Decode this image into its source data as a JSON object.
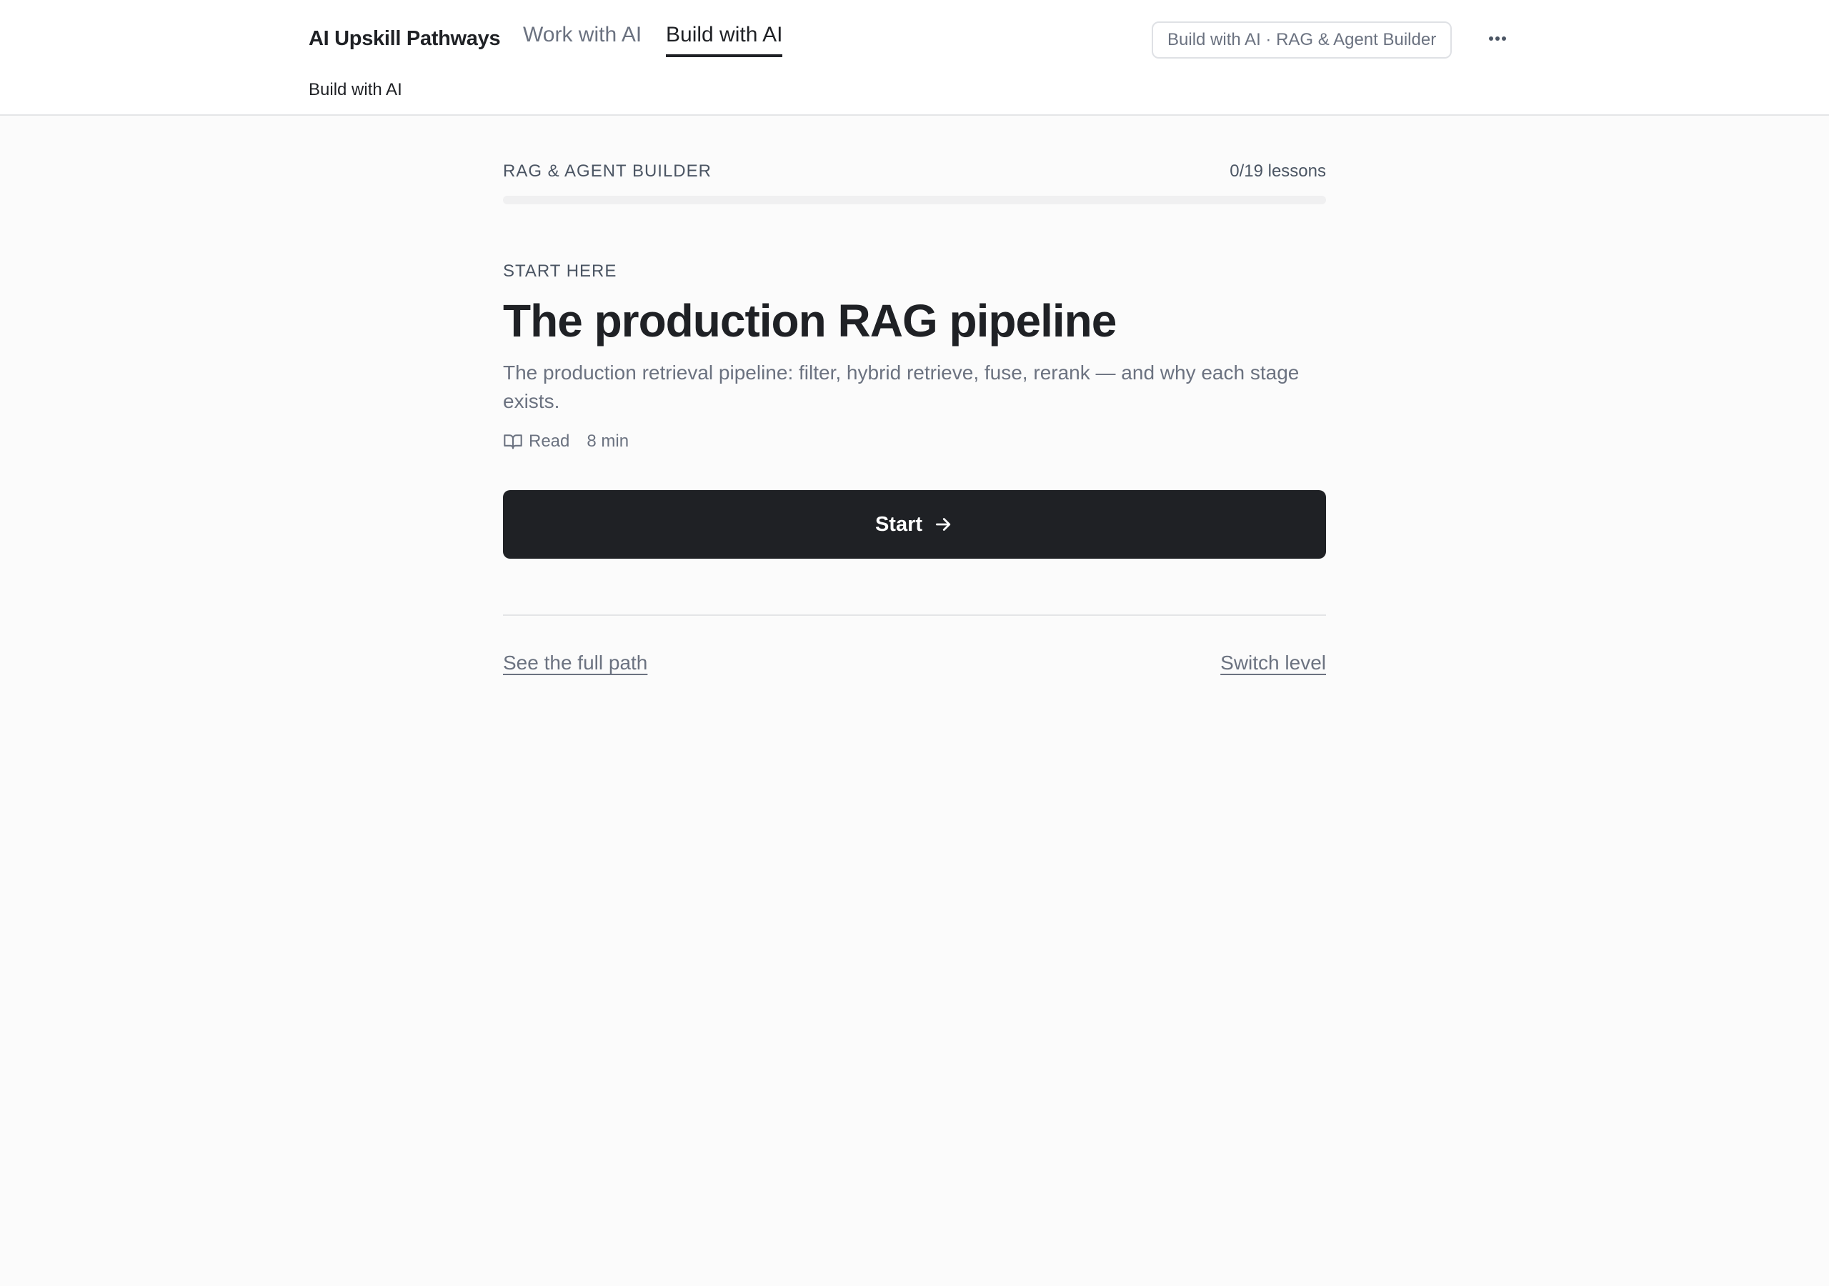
{
  "header": {
    "brand": "AI Upskill Pathways",
    "tabs": [
      {
        "label": "Work with AI",
        "active": false
      },
      {
        "label": "Build with AI",
        "active": true
      }
    ],
    "subnav_label": "Build with AI",
    "context_chip": "Build with AI · RAG & Agent Builder",
    "more_icon": "more-horizontal-icon"
  },
  "path": {
    "title": "RAG & AGENT BUILDER",
    "lessons_count": "0/19 lessons",
    "progress_fraction": 0
  },
  "lesson": {
    "eyebrow": "START HERE",
    "title": "The production RAG pipeline",
    "description": "The production retrieval pipeline: filter, hybrid retrieve, fuse, rerank — and why each stage exists.",
    "type_icon": "book-open-icon",
    "type_label": "Read",
    "duration": "8 min"
  },
  "actions": {
    "start_label": "Start",
    "start_icon": "arrow-right-icon",
    "full_path_link": "See the full path",
    "switch_level_link": "Switch level"
  },
  "colors": {
    "primary": "#1f2125",
    "muted_text": "#6b7280",
    "background": "#fbfbfb",
    "border": "#e4e5e7"
  }
}
